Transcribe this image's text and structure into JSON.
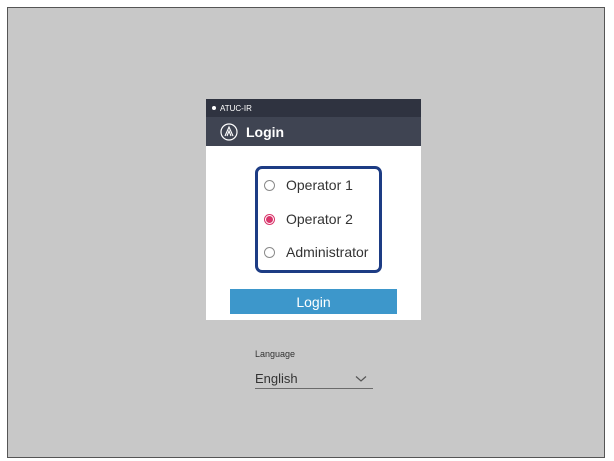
{
  "dialog": {
    "device_name": "ATUC-IR",
    "title": "Login",
    "roles": [
      {
        "label": "Operator 1",
        "selected": false
      },
      {
        "label": "Operator 2",
        "selected": true
      },
      {
        "label": "Administrator",
        "selected": false
      }
    ],
    "login_button": "Login"
  },
  "language": {
    "label": "Language",
    "selected": "English"
  },
  "colors": {
    "background": "#c8c8c8",
    "header": "#3f4452",
    "accent_button": "#3d97cb",
    "selection_box": "#1d3c84",
    "radio_selected": "#d9356b"
  },
  "icons": {
    "brand": "audio-technica-logo-icon",
    "dropdown": "chevron-down-icon"
  }
}
